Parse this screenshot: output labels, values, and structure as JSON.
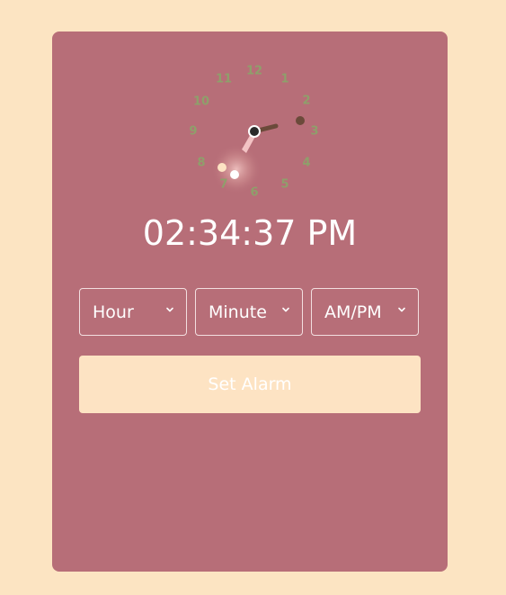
{
  "clock": {
    "numbers": [
      "12",
      "1",
      "2",
      "3",
      "4",
      "5",
      "6",
      "7",
      "8",
      "9",
      "10",
      "11"
    ],
    "time_text": "02:34:37 PM"
  },
  "alarm": {
    "hour_label": "Hour",
    "minute_label": "Minute",
    "ampm_label": "AM/PM",
    "button_label": "Set Alarm"
  },
  "colors": {
    "page_bg": "#fce4c2",
    "card_bg": "#b76e78",
    "numeral": "#8f9f6b",
    "button_bg": "#fde3c3"
  }
}
